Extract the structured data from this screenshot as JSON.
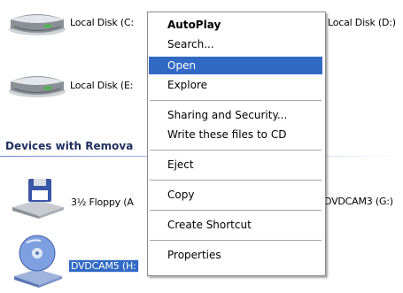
{
  "drives": {
    "local_c": "Local Disk (C:",
    "local_d": "Local Disk (D:)",
    "local_e": "Local Disk (E:",
    "floppy": "3½ Floppy (A",
    "dvd_g": "DVDCAM3 (G:)",
    "dvd_h": "DVDCAM5 (H:"
  },
  "section": {
    "removable_title": "Devices with Remova"
  },
  "context_menu": {
    "items": [
      {
        "label": "AutoPlay",
        "bold": true
      },
      {
        "label": "Search..."
      },
      {
        "label": "Open",
        "highlighted": true
      },
      {
        "label": "Explore"
      },
      {
        "label": "Sharing and Security..."
      },
      {
        "label": "Write these files to CD"
      },
      {
        "label": "Eject"
      },
      {
        "label": "Copy"
      },
      {
        "label": "Create Shortcut"
      },
      {
        "label": "Properties"
      }
    ]
  },
  "colors": {
    "selection": "#316ac5",
    "section_title": "#1f2f5f"
  }
}
